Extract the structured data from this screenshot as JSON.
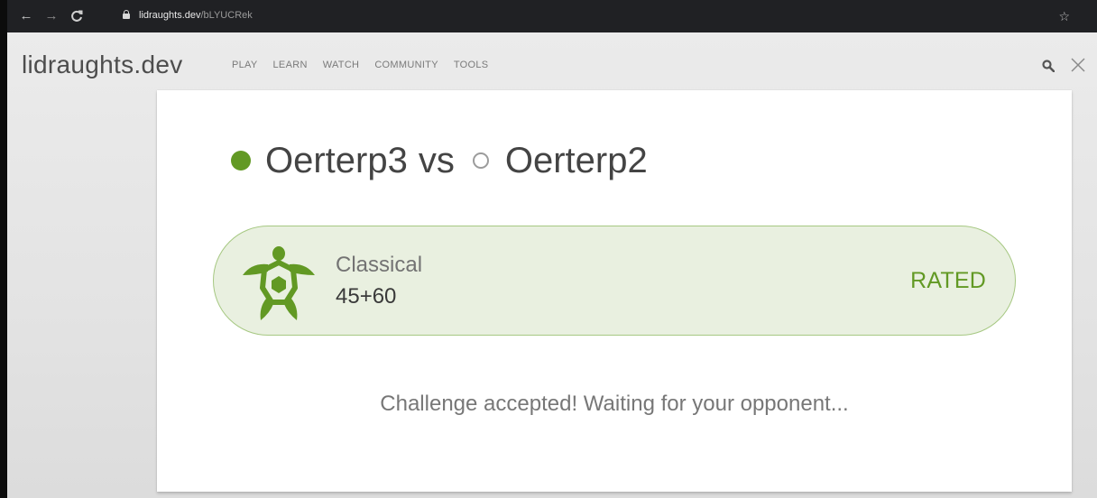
{
  "browser": {
    "url_host": "lidraughts.dev",
    "url_path": "/bLYUCRek"
  },
  "site": {
    "logo": "lidraughts.dev",
    "menu": [
      "PLAY",
      "LEARN",
      "WATCH",
      "COMMUNITY",
      "TOOLS"
    ]
  },
  "challenge": {
    "player1": "Oerterp3",
    "vs_label": "vs",
    "player2": "Oerterp2",
    "speed": "Classical",
    "clock": "45+60",
    "mode": "RATED",
    "status": "Challenge accepted! Waiting for your opponent..."
  },
  "colors": {
    "accent": "#629924",
    "pill_bg": "#e9f0e0",
    "pill_border": "#a6c882"
  },
  "icons": [
    "back-arrow-icon",
    "forward-arrow-icon",
    "reload-icon",
    "lock-icon",
    "bookmark-star-icon",
    "search-icon",
    "close-icon",
    "turtle-icon"
  ]
}
